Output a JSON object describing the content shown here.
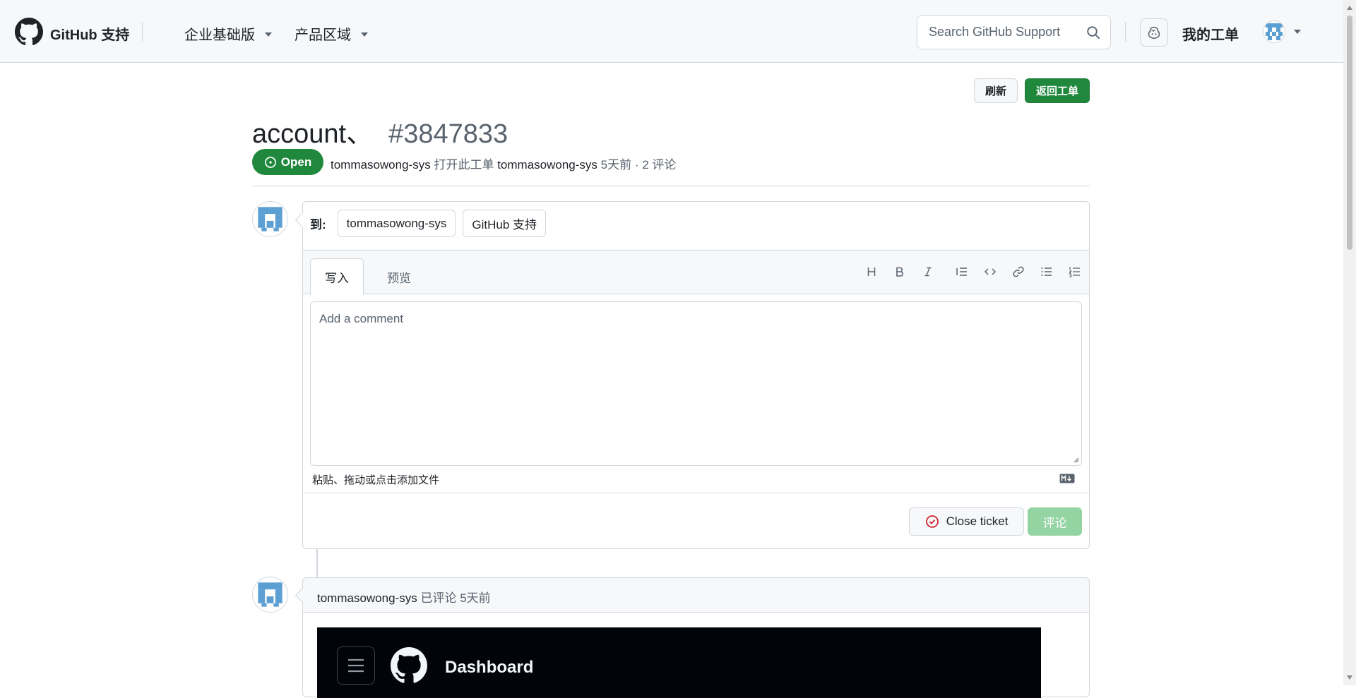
{
  "header": {
    "brand": "GitHub 支持",
    "nav": [
      {
        "label": "企业基础版"
      },
      {
        "label": "产品区域"
      }
    ],
    "search_placeholder": "Search GitHub Support",
    "my_tickets": "我的工单"
  },
  "actions": {
    "refresh": "刷新",
    "back_to_tickets": "返回工单"
  },
  "ticket": {
    "title": "account、",
    "number": "#3847833",
    "state": "Open",
    "meta": {
      "author": "tommasowong-sys",
      "opened_text": "打开此工单",
      "author2": "tommasowong-sys",
      "time": "5天前",
      "comments": "· 2 评论"
    }
  },
  "compose": {
    "to_label": "到:",
    "recipients": [
      "tommasowong-sys",
      "GitHub 支持"
    ],
    "tab_write": "写入",
    "tab_preview": "预览",
    "toolbar_icons": [
      "heading-icon",
      "bold-icon",
      "italic-icon",
      "quote-icon",
      "code-icon",
      "link-icon",
      "unordered-list-icon",
      "ordered-list-icon"
    ],
    "placeholder": "Add a comment",
    "attach_hint": "粘贴、拖动或点击添加文件",
    "close_ticket": "Close ticket",
    "comment": "评论"
  },
  "timeline": [
    {
      "author": "tommasowong-sys",
      "action": "已评论",
      "time": "5天前",
      "embedded_screenshot": {
        "title": "Dashboard"
      }
    }
  ],
  "colors": {
    "primary_green": "#1f883d",
    "disabled_green": "#94d3a2",
    "border": "#d0d7de",
    "muted_text": "#59636e",
    "close_icon_red": "#cf222e"
  }
}
